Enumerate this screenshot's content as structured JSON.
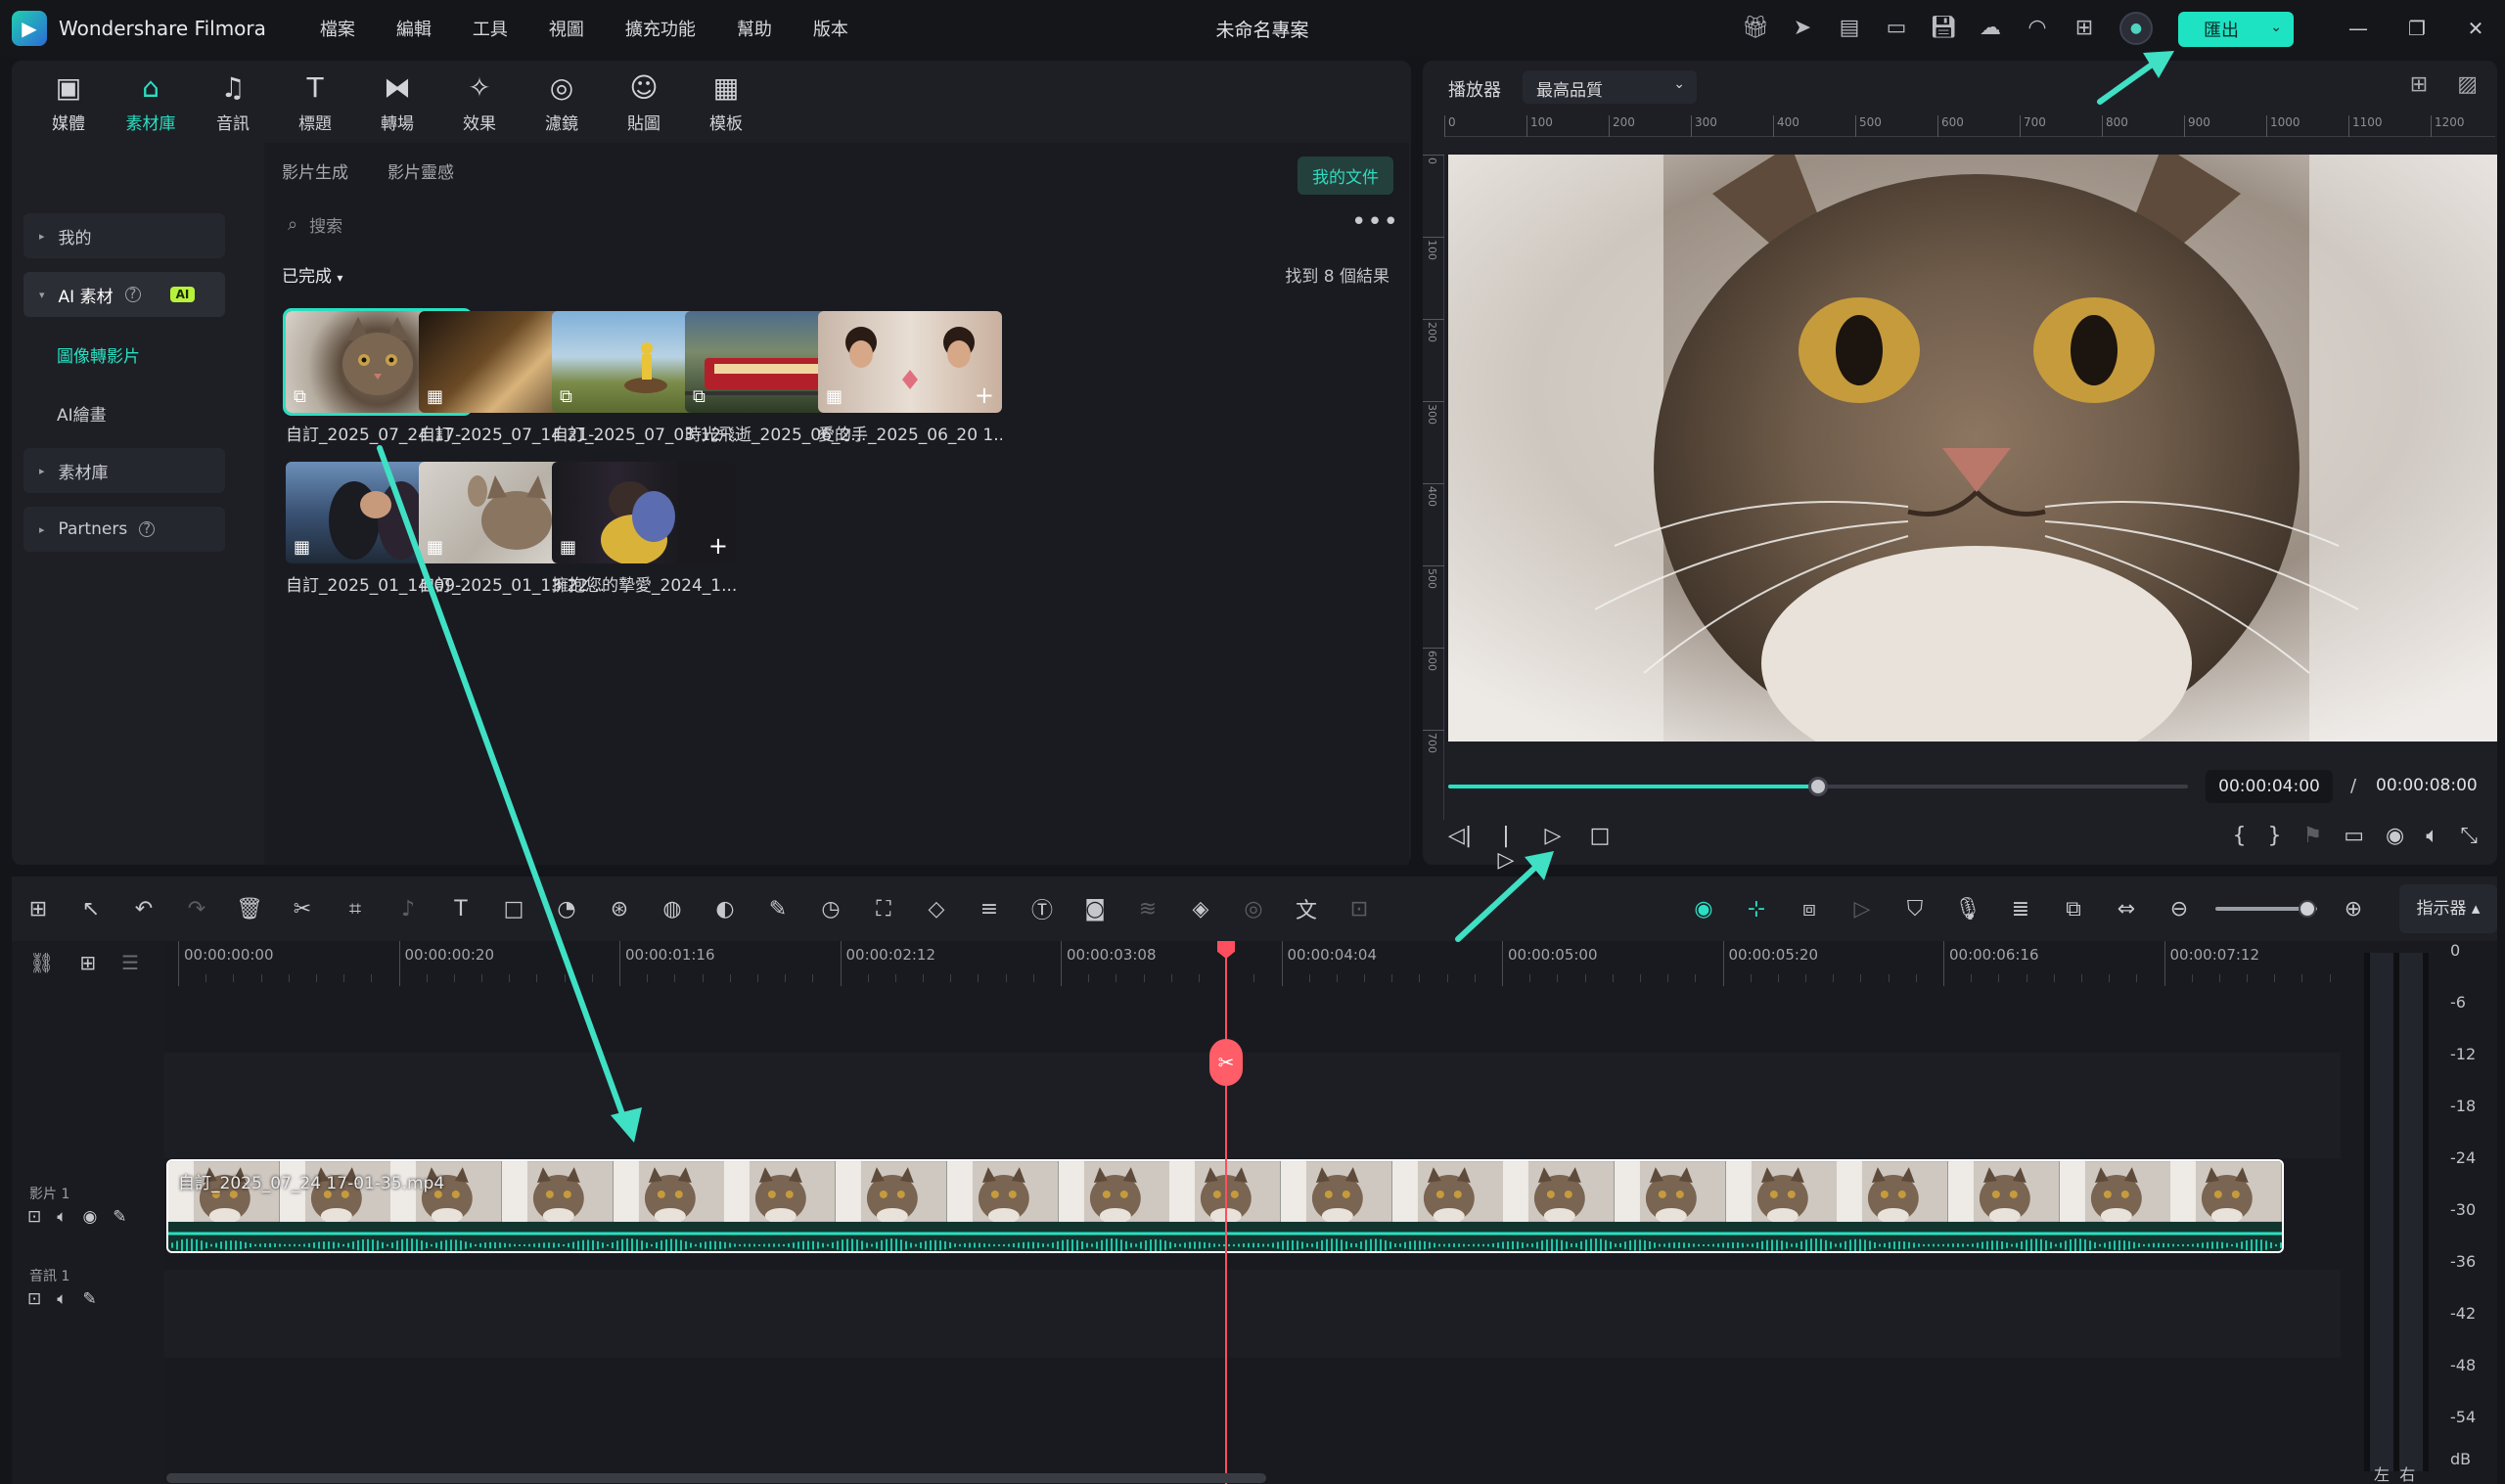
{
  "app": {
    "name": "Wondershare Filmora",
    "project_title": "未命名專案",
    "export_label": "匯出"
  },
  "menu": [
    "檔案",
    "編輯",
    "工具",
    "視圖",
    "擴充功能",
    "幫助",
    "版本"
  ],
  "library_tabs": [
    {
      "label": "媒體",
      "icon": "media-icon"
    },
    {
      "label": "素材庫",
      "icon": "stock-icon"
    },
    {
      "label": "音訊",
      "icon": "audio-icon"
    },
    {
      "label": "標題",
      "icon": "title-icon"
    },
    {
      "label": "轉場",
      "icon": "transition-icon"
    },
    {
      "label": "效果",
      "icon": "effects-icon"
    },
    {
      "label": "濾鏡",
      "icon": "filter-icon"
    },
    {
      "label": "貼圖",
      "icon": "sticker-icon"
    },
    {
      "label": "模板",
      "icon": "template-icon"
    }
  ],
  "sidebar": {
    "mine": "我的",
    "ai_assets": "AI 素材",
    "ai_badge": "AI",
    "image_to_video": "圖像轉影片",
    "ai_drawing": "AI繪畫",
    "stock": "素材庫",
    "partners": "Partners"
  },
  "content": {
    "sub_tabs": [
      "影片生成",
      "影片靈感"
    ],
    "my_files": "我的文件",
    "search_placeholder": "搜索",
    "filter": "已完成",
    "result_count": "找到 8 個結果",
    "items": [
      {
        "caption": "自訂_2025_07_24 17-..."
      },
      {
        "caption": "自訂_2025_07_14 21-..."
      },
      {
        "caption": "自訂_2025_07_03 12-..."
      },
      {
        "caption": "時光飛逝_2025_06_2..."
      },
      {
        "caption": "愛的手_2025_06_20 1..."
      },
      {
        "caption": "自訂_2025_01_14 09-..."
      },
      {
        "caption": "自訂_2025_01_13 22-..."
      },
      {
        "caption": "擁抱您的摯愛_2024_1..."
      }
    ]
  },
  "player": {
    "label": "播放器",
    "quality": "最高品質",
    "ruler_h": [
      "0",
      "100",
      "200",
      "300",
      "400",
      "500",
      "600",
      "700",
      "800",
      "900",
      "1000",
      "1100",
      "1200"
    ],
    "ruler_v": [
      "0",
      "100",
      "200",
      "300",
      "400",
      "500",
      "600",
      "700"
    ],
    "time_current": "00:00:04:00",
    "time_separator": "/",
    "time_total": "00:00:08:00",
    "progress": 0.5
  },
  "timeline": {
    "ruler": [
      "00:00:00:00",
      "00:00:00:20",
      "00:00:01:16",
      "00:00:02:12",
      "00:00:03:08",
      "00:00:04:04",
      "00:00:05:00",
      "00:00:05:20",
      "00:00:06:16",
      "00:00:07:12"
    ],
    "video_track": "影片 1",
    "audio_track": "音訊 1",
    "clip_name": "自訂_2025_07_24 17-01-35.mp4",
    "meter_toggle": "指示器",
    "zoom": 0.9
  },
  "meter": {
    "labels": [
      "0",
      "-6",
      "-12",
      "-18",
      "-24",
      "-30",
      "-36",
      "-42",
      "-48",
      "-54",
      "dB"
    ],
    "left": "左",
    "right": "右"
  },
  "colors": {
    "accent": "#29e0c2",
    "playhead": "#ff4f5e",
    "export": "#1ee3c3"
  }
}
